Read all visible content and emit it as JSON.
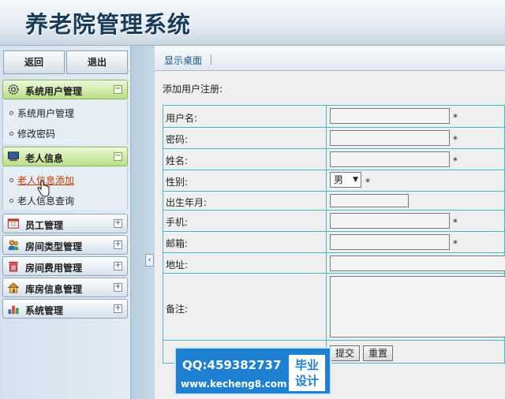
{
  "app": {
    "title": "养老院管理系统"
  },
  "sidebar": {
    "back_label": "返回",
    "exit_label": "退出",
    "groups": [
      {
        "label": "系统用户管理",
        "toggle": "−",
        "items": [
          "系统用户管理",
          "修改密码"
        ]
      },
      {
        "label": "老人信息",
        "toggle": "−",
        "items": [
          "老人信息添加",
          "老人信息查询"
        ]
      },
      {
        "label": "员工管理",
        "toggle": "+"
      },
      {
        "label": "房间类型管理",
        "toggle": "+"
      },
      {
        "label": "房间费用管理",
        "toggle": "+"
      },
      {
        "label": "库房信息管理",
        "toggle": "+"
      },
      {
        "label": "系统管理",
        "toggle": "+"
      }
    ],
    "collapse_glyph": "‹"
  },
  "main": {
    "tab_label": "显示桌面",
    "heading": "添加用户注册:",
    "form": {
      "username_label": "用户名:",
      "password_label": "密码:",
      "name_label": "姓名:",
      "gender_label": "性别:",
      "gender_value": "男",
      "birth_label": "出生年月:",
      "phone_label": "手机:",
      "email_label": "邮箱:",
      "address_label": "地址:",
      "notes_label": "备注:",
      "required_mark": "*",
      "submit_label": "提交",
      "reset_label": "重置"
    }
  },
  "watermark": {
    "qq": "QQ:459382737",
    "url": "www.kecheng8.com",
    "badge_line1": "毕业",
    "badge_line2": "设计"
  },
  "colors": {
    "table_border": "#47b9c2",
    "active_menu": "#b9df86",
    "title": "#183c5a",
    "watermark_bg": "#1f7fd1"
  },
  "icons": [
    "gear-icon",
    "monitor-icon",
    "calendar-icon",
    "people-icon",
    "trash-icon",
    "house-icon",
    "chart-icon",
    "hand-pointer-icon"
  ]
}
